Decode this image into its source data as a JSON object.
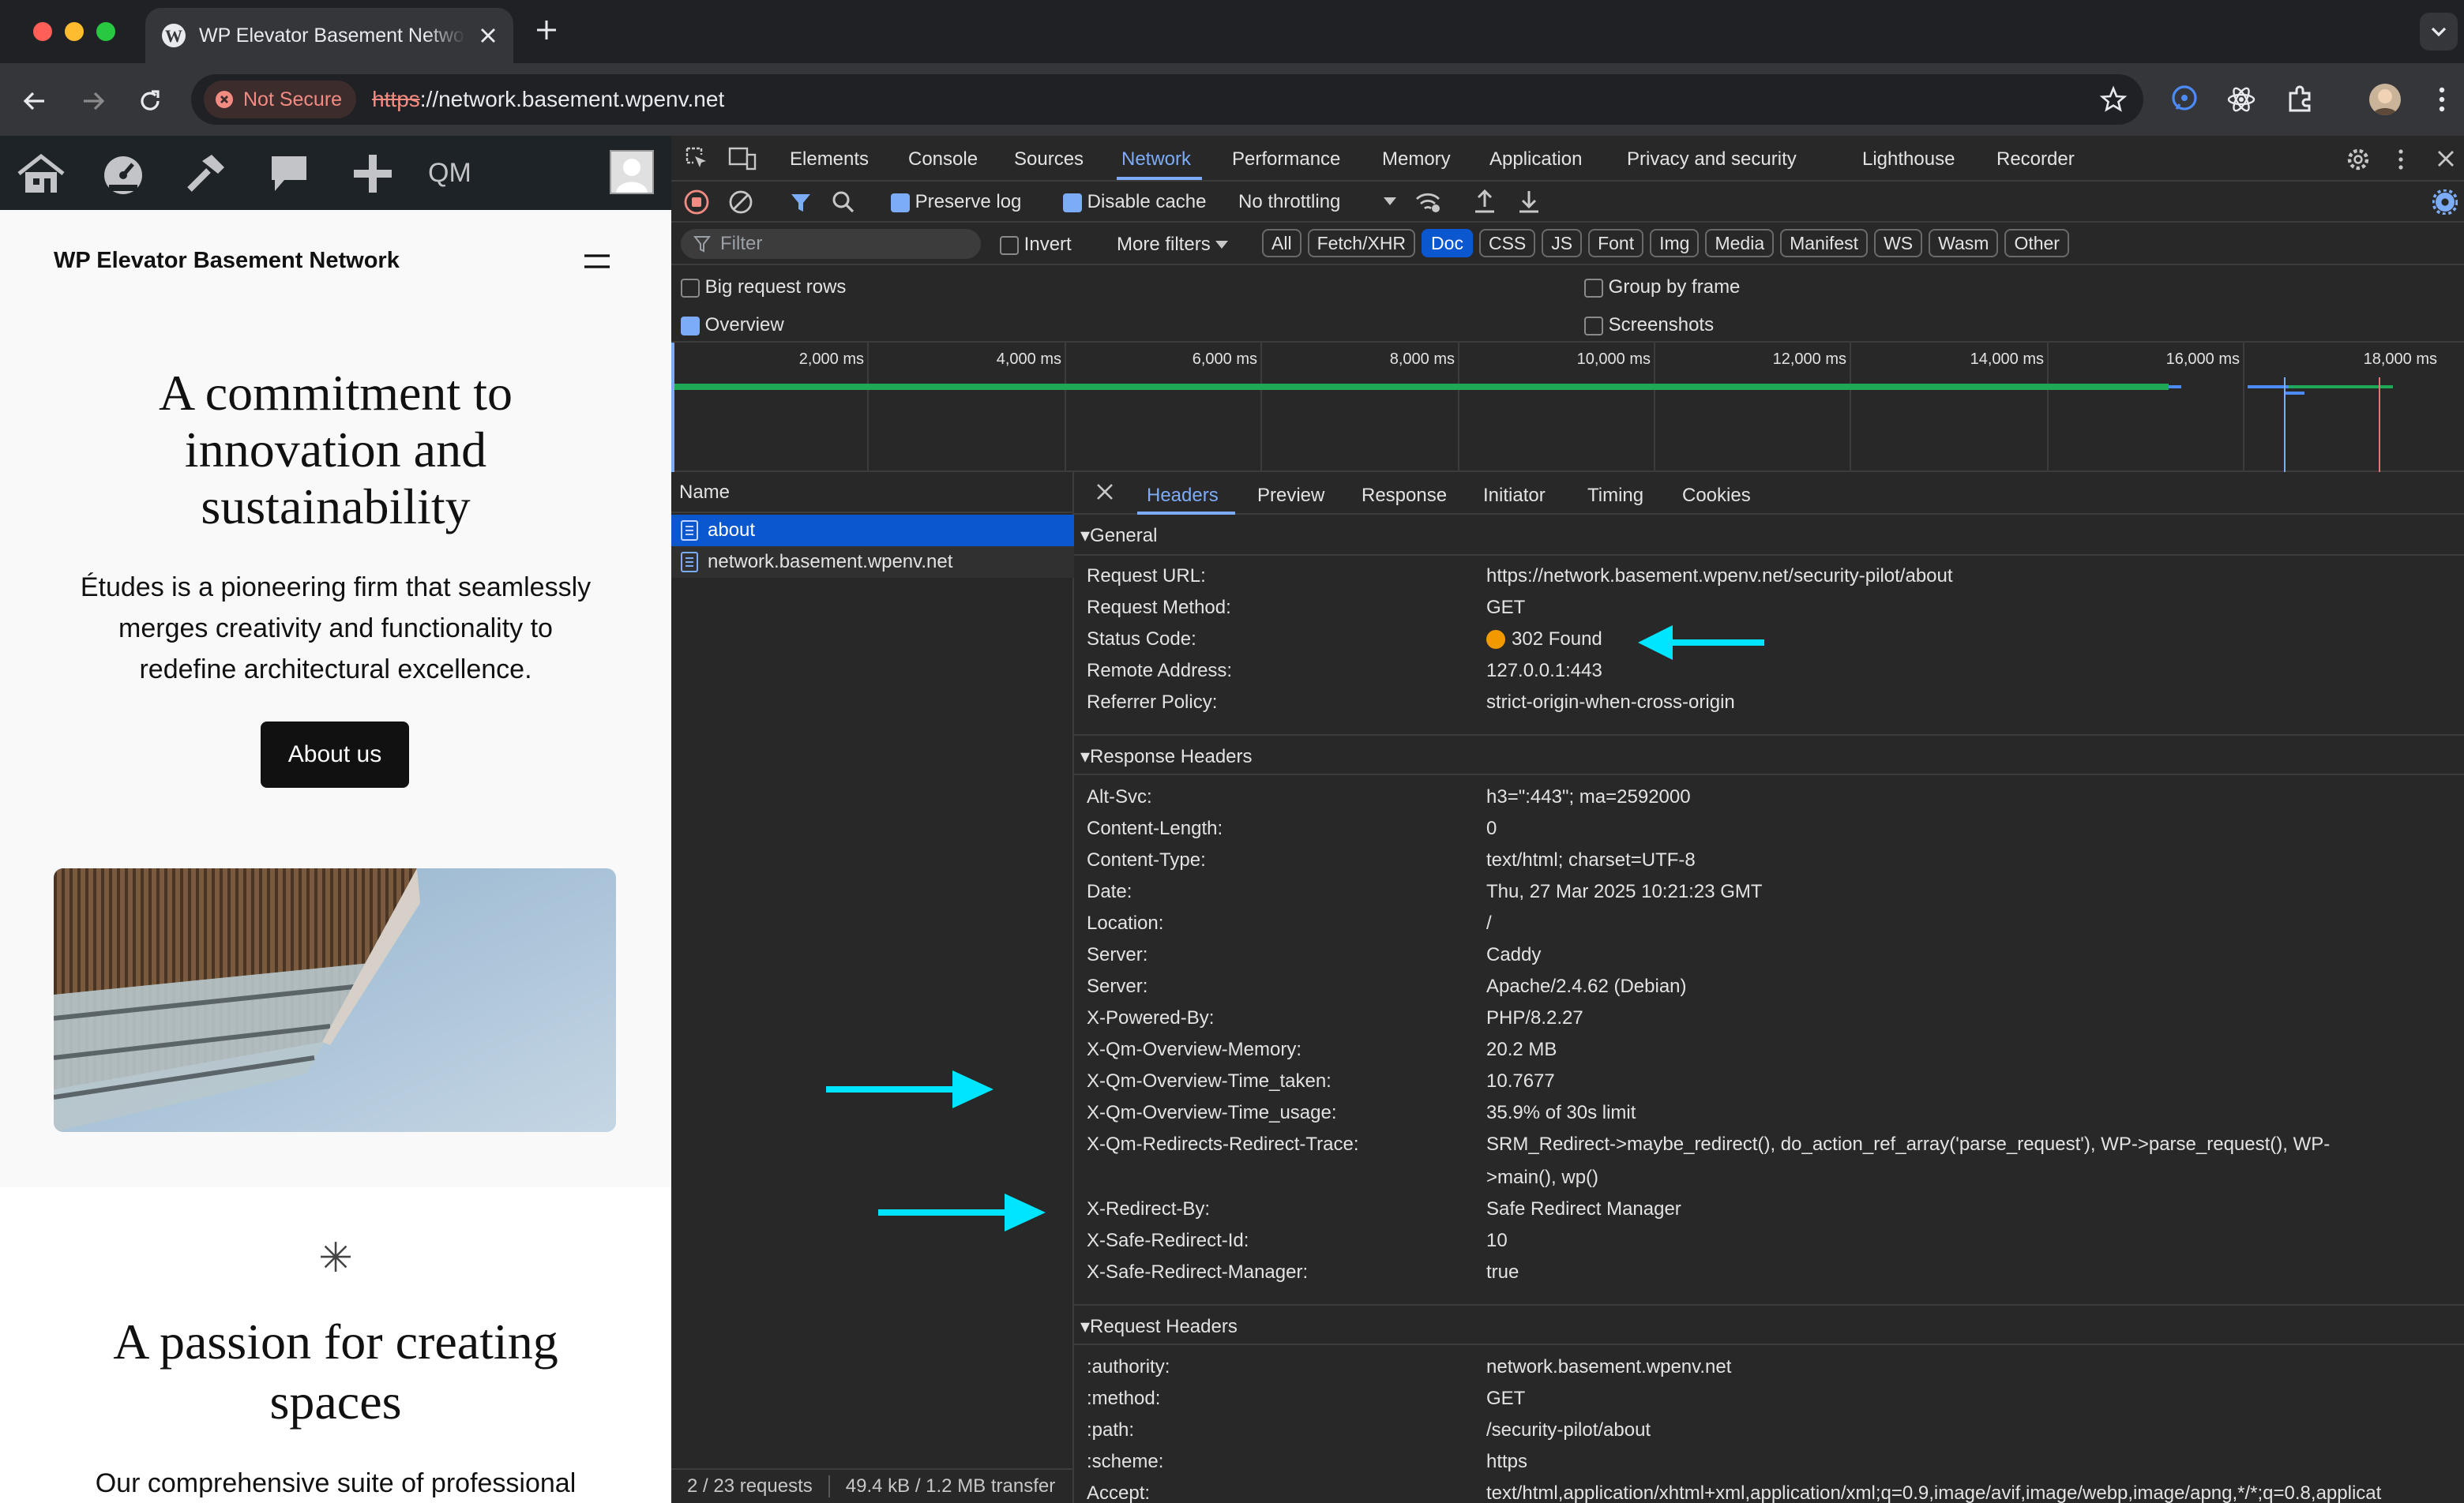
{
  "browser": {
    "tab_title": "WP Elevator Basement Netwo",
    "security_label": "Not Secure",
    "url_scheme": "https",
    "url_rest": "://network.basement.wpenv.net"
  },
  "wp_admin_bar": {
    "qm_label": "QM"
  },
  "site": {
    "title": "WP Elevator Basement Network",
    "hero_heading_lines": [
      "A commitment to",
      "innovation and",
      "sustainability"
    ],
    "hero_text_lines": [
      "Études is a pioneering firm that seamlessly",
      "merges creativity and functionality to",
      "redefine architectural excellence."
    ],
    "about_button": "About us",
    "asterisk": "✳",
    "heading2_lines": [
      "A passion for creating",
      "spaces"
    ],
    "text2": "Our comprehensive suite of professional"
  },
  "devtools": {
    "panels": [
      "Elements",
      "Console",
      "Sources",
      "Network",
      "Performance",
      "Memory",
      "Application",
      "Privacy and security",
      "Lighthouse",
      "Recorder"
    ],
    "active_panel": "Network",
    "preserve_log": "Preserve log",
    "disable_cache": "Disable cache",
    "throttling": "No throttling",
    "filter_placeholder": "Filter",
    "invert": "Invert",
    "more_filters": "More filters",
    "type_filters": [
      "All",
      "Fetch/XHR",
      "Doc",
      "CSS",
      "JS",
      "Font",
      "Img",
      "Media",
      "Manifest",
      "WS",
      "Wasm",
      "Other"
    ],
    "active_type": "Doc",
    "options": {
      "big_rows": "Big request rows",
      "group_frame": "Group by frame",
      "overview": "Overview",
      "screenshots": "Screenshots"
    },
    "timeline_ticks": [
      "2,000 ms",
      "4,000 ms",
      "6,000 ms",
      "8,000 ms",
      "10,000 ms",
      "12,000 ms",
      "14,000 ms",
      "16,000 ms",
      "18,000 ms"
    ],
    "name_header": "Name",
    "requests": [
      "about",
      "network.basement.wpenv.net"
    ],
    "status_requests": "2 / 23 requests",
    "status_transfer": "49.4 kB / 1.2 MB transfer",
    "detail_tabs": [
      "Headers",
      "Preview",
      "Response",
      "Initiator",
      "Timing",
      "Cookies"
    ],
    "active_detail_tab": "Headers",
    "general_title": "General",
    "general": [
      {
        "k": "Request URL:",
        "v": "https://network.basement.wpenv.net/security-pilot/about"
      },
      {
        "k": "Request Method:",
        "v": "GET"
      },
      {
        "k": "Status Code:",
        "v": "302 Found"
      },
      {
        "k": "Remote Address:",
        "v": "127.0.0.1:443"
      },
      {
        "k": "Referrer Policy:",
        "v": "strict-origin-when-cross-origin"
      }
    ],
    "response_title": "Response Headers",
    "response": [
      {
        "k": "Alt-Svc:",
        "v": "h3=\":443\"; ma=2592000"
      },
      {
        "k": "Content-Length:",
        "v": "0"
      },
      {
        "k": "Content-Type:",
        "v": "text/html; charset=UTF-8"
      },
      {
        "k": "Date:",
        "v": "Thu, 27 Mar 2025 10:21:23 GMT"
      },
      {
        "k": "Location:",
        "v": "/"
      },
      {
        "k": "Server:",
        "v": "Caddy"
      },
      {
        "k": "Server:",
        "v": "Apache/2.4.62 (Debian)"
      },
      {
        "k": "X-Powered-By:",
        "v": "PHP/8.2.27"
      },
      {
        "k": "X-Qm-Overview-Memory:",
        "v": "20.2 MB"
      },
      {
        "k": "X-Qm-Overview-Time_taken:",
        "v": "10.7677"
      },
      {
        "k": "X-Qm-Overview-Time_usage:",
        "v": "35.9% of 30s limit"
      },
      {
        "k": "X-Qm-Redirects-Redirect-Trace:",
        "v": "SRM_Redirect->maybe_redirect(), do_action_ref_array('parse_request'), WP->parse_request(), WP-",
        "v2": ">main(), wp()"
      },
      {
        "k": "X-Redirect-By:",
        "v": "Safe Redirect Manager"
      },
      {
        "k": "X-Safe-Redirect-Id:",
        "v": "10"
      },
      {
        "k": "X-Safe-Redirect-Manager:",
        "v": "true"
      }
    ],
    "request_title": "Request Headers",
    "request": [
      {
        "k": ":authority:",
        "v": "network.basement.wpenv.net"
      },
      {
        "k": ":method:",
        "v": "GET"
      },
      {
        "k": ":path:",
        "v": "/security-pilot/about"
      },
      {
        "k": ":scheme:",
        "v": "https"
      },
      {
        "k": "Accept:",
        "v": "text/html,application/xhtml+xml,application/xml;q=0.9,image/avif,image/webp,image/apng,*/*;q=0.8,applicat"
      }
    ]
  },
  "colors": {
    "accent_blue": "#7cacf8",
    "status_dot": "#f29900",
    "arrow": "#00e5ff",
    "overview_bar": "#1fa855"
  }
}
